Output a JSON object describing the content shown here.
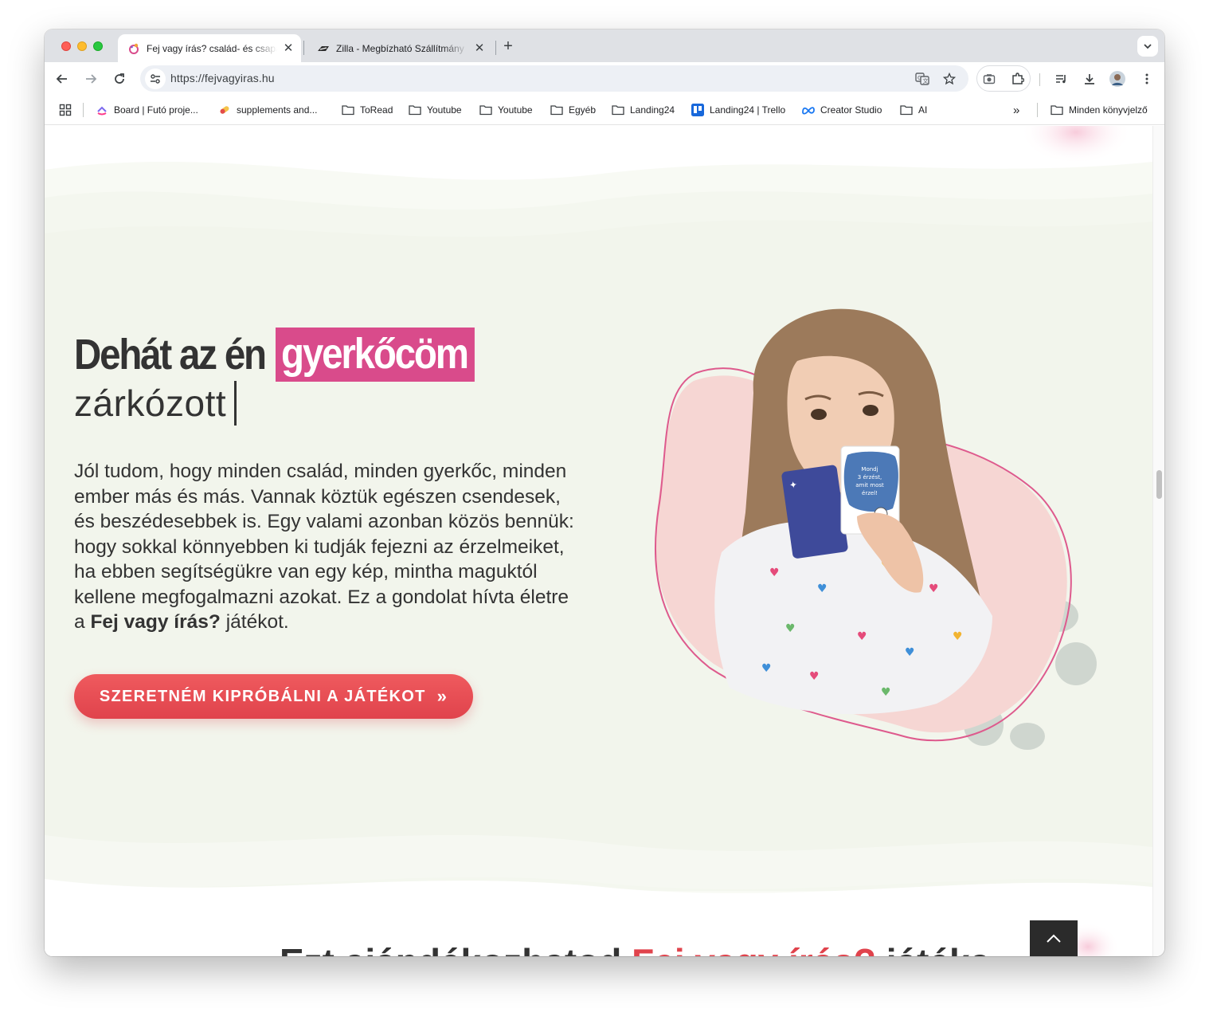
{
  "browser": {
    "tabs": [
      {
        "title": "Fej vagy írás? család- és csapat",
        "active": true
      },
      {
        "title": "Zilla - Megbízható Szállítmány",
        "active": false
      }
    ],
    "url": "https://fejvagyiras.hu",
    "bookmarks": [
      {
        "label": "Board | Futó proje...",
        "icon": "clickup-icon"
      },
      {
        "label": "supplements and...",
        "icon": "pill-icon"
      },
      {
        "label": "ToRead",
        "icon": "folder-icon"
      },
      {
        "label": "Youtube",
        "icon": "folder-icon"
      },
      {
        "label": "Youtube",
        "icon": "folder-icon"
      },
      {
        "label": "Egyéb",
        "icon": "folder-icon"
      },
      {
        "label": "Landing24",
        "icon": "folder-icon"
      },
      {
        "label": "Landing24 | Trello",
        "icon": "trello-icon"
      },
      {
        "label": "Creator Studio",
        "icon": "meta-icon"
      },
      {
        "label": "AI",
        "icon": "folder-icon"
      }
    ],
    "overflow_label": "»",
    "all_bookmarks": "Minden könyvjelző"
  },
  "hero": {
    "headline_prefix": "Dehát az én",
    "headline_highlight": "gyerkőcöm",
    "headline_typed": "zárkózott",
    "paragraph_intro": "Jól tudom, hogy minden család, minden gyerkőc, minden ember más és más. Vannak köztük egészen csendesek, és beszédesebbek is. Egy valami azonban közös bennük: hogy sokkal könnyebben ki tudják fejezni az érzelmeiket, ha ebben segítségükre van egy kép, mintha maguktól kellene megfogalmazni azokat. Ez a gondolat hívta életre a",
    "paragraph_bold": "Fej vagy írás?",
    "paragraph_outro": "játékot.",
    "cta_label": "SZERETNÉM KIPRÓBÁLNI A JÁTÉKOT",
    "card_text": [
      "Mondj",
      "3 érzést,",
      "amit most",
      "érzel!"
    ]
  },
  "next_section": {
    "heading_start": "Ezt ajándékozhatod",
    "heading_accent": "Fej vagy írás?",
    "heading_end": "játéka"
  },
  "colors": {
    "accent_pink": "#d94b8b",
    "cta_red": "#e0434c",
    "section_bg": "#f2f5ec",
    "blob_pink": "#f6d6d3",
    "pebble_gray": "#cfd6cf"
  }
}
